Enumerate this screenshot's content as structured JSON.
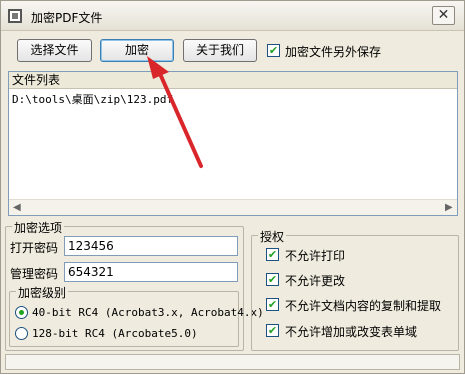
{
  "window": {
    "title": "加密PDF文件",
    "close_symbol": "✕"
  },
  "toolbar": {
    "select_file_label": "选择文件",
    "encrypt_label": "加密",
    "about_label": "关于我们",
    "save_copy_label": "加密文件另外保存",
    "save_copy_checked": true
  },
  "filelist": {
    "header": "文件列表",
    "files": [
      "D:\\tools\\桌面\\zip\\123.pdf"
    ]
  },
  "encrypt_options": {
    "title": "加密选项",
    "open_password_label": "打开密码",
    "open_password_value": "123456",
    "admin_password_label": "管理密码",
    "admin_password_value": "654321",
    "level_title": "加密级别",
    "levels": [
      {
        "label": "40-bit RC4 (Acrobat3.x, Acrobat4.x)",
        "selected": true
      },
      {
        "label": "128-bit RC4 (Arcobate5.0)",
        "selected": false
      }
    ]
  },
  "permissions": {
    "title": "授权",
    "items": [
      {
        "label": "不允许打印",
        "checked": true
      },
      {
        "label": "不允许更改",
        "checked": true
      },
      {
        "label": "不允许文档内容的复制和提取",
        "checked": true
      },
      {
        "label": "不允许增加或改变表单域",
        "checked": true
      }
    ]
  },
  "colors": {
    "annotation_arrow": "#d9262b",
    "check_mark": "#21a121"
  }
}
